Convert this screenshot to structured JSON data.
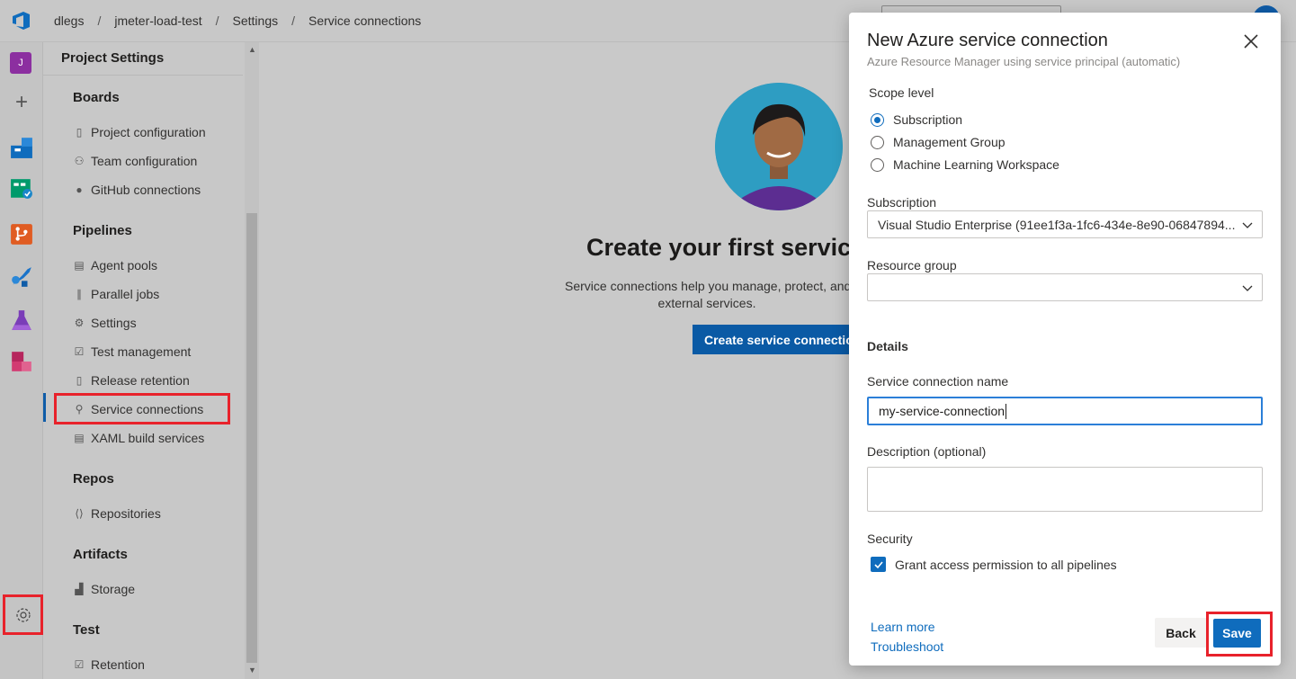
{
  "breadcrumb": [
    "dlegs",
    "jmeter-load-test",
    "Settings",
    "Service connections"
  ],
  "rail": {
    "project_initial": "J"
  },
  "nav": {
    "title": "Project Settings",
    "sections": {
      "boards": "Boards",
      "pipelines": "Pipelines",
      "repos": "Repos",
      "artifacts": "Artifacts",
      "test": "Test"
    },
    "items": {
      "project_configuration": "Project configuration",
      "team_configuration": "Team configuration",
      "github_connections": "GitHub connections",
      "agent_pools": "Agent pools",
      "parallel_jobs": "Parallel jobs",
      "settings": "Settings",
      "test_management": "Test management",
      "release_retention": "Release retention",
      "service_connections": "Service connections",
      "xaml_build_services": "XAML build services",
      "repositories": "Repositories",
      "storage": "Storage",
      "retention": "Retention"
    }
  },
  "main": {
    "title": "Create your first service",
    "desc_line1": "Service connections help you manage, protect, and",
    "desc_line2": "external services.",
    "create_button": "Create service connection"
  },
  "panel": {
    "title": "New Azure service connection",
    "subtitle": "Azure Resource Manager using service principal (automatic)",
    "scope_label": "Scope level",
    "scope_options": [
      "Subscription",
      "Management Group",
      "Machine Learning Workspace"
    ],
    "scope_selected": "Subscription",
    "subscription_label": "Subscription",
    "subscription_value": "Visual Studio Enterprise (91ee1f3a-1fc6-434e-8e90-06847894...",
    "resource_group_label": "Resource group",
    "resource_group_value": "",
    "details_heading": "Details",
    "name_label": "Service connection name",
    "name_value": "my-service-connection",
    "description_label": "Description (optional)",
    "security_label": "Security",
    "grant_access_label": "Grant access permission to all pipelines",
    "grant_access_checked": true,
    "learn_more": "Learn more",
    "troubleshoot": "Troubleshoot",
    "back_button": "Back",
    "save_button": "Save"
  },
  "colors": {
    "accent": "#0f6cbd",
    "highlight_box": "#e8222b",
    "project_avatar": "#8c2fa0"
  }
}
